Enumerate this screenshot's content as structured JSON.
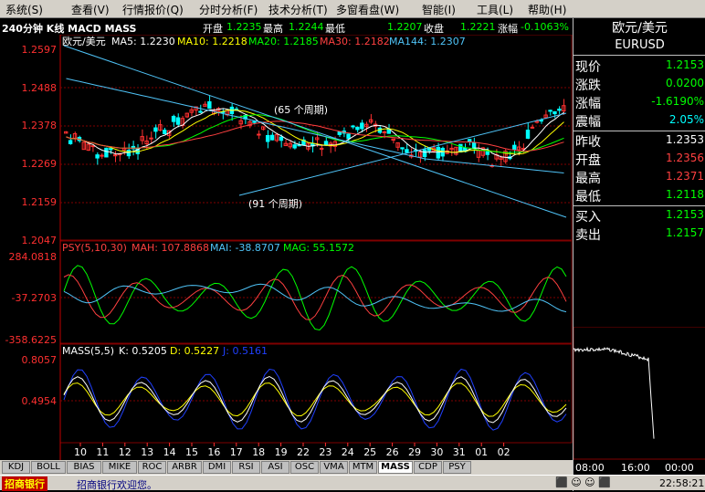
{
  "menu": [
    "系统(S)",
    "查看(V)",
    "行情报价(Q)",
    "分时分析(F)",
    "技术分析(T)",
    "多窗看盘(W)",
    "智能(I)",
    "工具(L)",
    "帮助(H)"
  ],
  "chart_title": "240分钟 K线 MACD MASS",
  "quote_bar": {
    "open_label": "开盘",
    "open": "1.2235",
    "high_label": "最高",
    "high": "1.2244",
    "low_label": "最低",
    "low": "1.2207",
    "close_label": "收盘",
    "close": "1.2221",
    "chg_label": "涨幅",
    "chg": "-0.1063%"
  },
  "main_legend": {
    "symbol": "欧元/美元",
    "ma5": "MA5: 1.2230",
    "ma10": "MA10: 1.2218",
    "ma20": "MA20: 1.2185",
    "ma30": "MA30: 1.2182",
    "ma144": "MA144: 1.2307"
  },
  "main_axis": [
    "1.2597",
    "1.2488",
    "1.2378",
    "1.2269",
    "1.2159",
    "1.2047"
  ],
  "annotations": [
    "(65 个周期)",
    "(91 个周期)"
  ],
  "psy_legend": {
    "name": "PSY(5,10,30)",
    "mah": "MAH: 107.8868",
    "mai": "MAI: -38.8707",
    "mag": "MAG: 55.1572"
  },
  "psy_axis": [
    "284.0818",
    "-37.2703",
    "-358.6225"
  ],
  "mass_legend": {
    "name": "MASS(5,5)",
    "k": "K: 0.5205",
    "d": "D: 0.5227",
    "j": "J: 0.5161"
  },
  "mass_axis": [
    "0.8057",
    "0.4954"
  ],
  "x_labels": [
    "10",
    "11",
    "12",
    "13",
    "14",
    "15",
    "16",
    "17",
    "18",
    "19",
    "22",
    "23",
    "24",
    "25",
    "26",
    "29",
    "30",
    "31",
    "01",
    "02"
  ],
  "tabs": [
    "KDJ",
    "BOLL",
    "BIAS",
    "MIKE",
    "ROC",
    "ARBR",
    "DMI",
    "RSI",
    "ASI",
    "OSC",
    "VMA",
    "MTM",
    "MASS",
    "CDP",
    "PSY"
  ],
  "active_tab": "MASS",
  "right_panel": {
    "title": "欧元/美元",
    "code": "EURUSD",
    "rows": [
      {
        "label": "现价",
        "value": "1.2153",
        "color": "#00ff00"
      },
      {
        "label": "涨跌",
        "value": "0.0200",
        "color": "#00ff00"
      },
      {
        "label": "涨幅",
        "value": "-1.6190%",
        "color": "#00ff00"
      },
      {
        "label": "震幅",
        "value": "2.05%",
        "color": "#00ffff"
      },
      {
        "label": "昨收",
        "value": "1.2353",
        "color": "#ffffff"
      },
      {
        "label": "开盘",
        "value": "1.2356",
        "color": "#ff4040"
      },
      {
        "label": "最高",
        "value": "1.2371",
        "color": "#ff4040"
      },
      {
        "label": "最低",
        "value": "1.2118",
        "color": "#00ff00"
      },
      {
        "label": "买入",
        "value": "1.2153",
        "color": "#00ff00"
      },
      {
        "label": "卖出",
        "value": "1.2157",
        "color": "#00ff00"
      }
    ],
    "time_labels": [
      "08:00",
      "16:00",
      "00:00"
    ]
  },
  "status": {
    "logo": "招商银行",
    "ticker": "招商银行欢迎您。",
    "time": "22:58:21"
  },
  "colors": {
    "up": "#ff3030",
    "down": "#00ffff",
    "grid": "#800000",
    "ma5": "#ffffff",
    "ma10": "#ffff00",
    "ma20": "#00ff00",
    "ma30": "#ff4040",
    "ma144": "#4fc3f7",
    "axis": "#ff3030"
  }
}
